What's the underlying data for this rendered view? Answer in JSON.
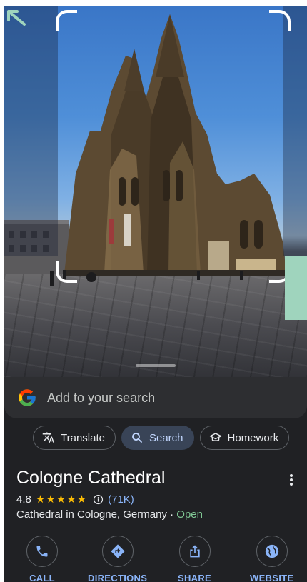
{
  "search_bar": {
    "placeholder": "Add to your search"
  },
  "chips": [
    {
      "label": "Translate",
      "icon": "translate-icon",
      "active": false
    },
    {
      "label": "Search",
      "icon": "search-icon",
      "active": true
    },
    {
      "label": "Homework",
      "icon": "homework-icon",
      "active": false
    }
  ],
  "place": {
    "name": "Cologne Cathedral",
    "rating": "4.8",
    "stars": "★★★★★",
    "reviews": "(71K)",
    "category": "Cathedral in Cologne, Germany · ",
    "status": "Open"
  },
  "actions": [
    {
      "label": "CALL",
      "icon": "phone-icon"
    },
    {
      "label": "DIRECTIONS",
      "icon": "directions-icon"
    },
    {
      "label": "SHARE",
      "icon": "share-icon"
    },
    {
      "label": "WEBSITE",
      "icon": "globe-icon"
    }
  ],
  "colors": {
    "accent": "#8ab4f8",
    "open": "#81c995",
    "stars": "#fbbc04",
    "sheet_bg": "#202124",
    "search_bg": "#2d2e31"
  }
}
